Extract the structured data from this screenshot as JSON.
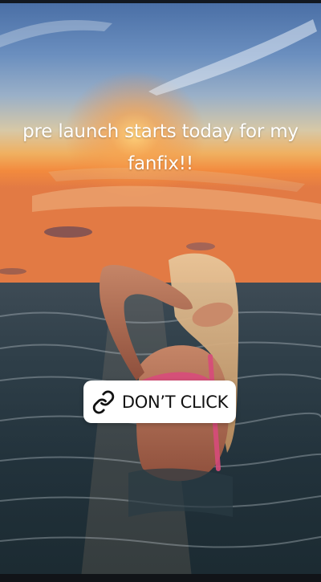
{
  "story": {
    "caption": "pre launch starts today for my fanfix!!",
    "link_sticker": {
      "label": "DON’T CLICK",
      "icon": "link-icon"
    },
    "photo": {
      "icon": "sunset-ocean-photo"
    }
  },
  "colors": {
    "sticker_background": "#ffffff",
    "sticker_text": "#111111",
    "caption_text": "#ffffff"
  }
}
